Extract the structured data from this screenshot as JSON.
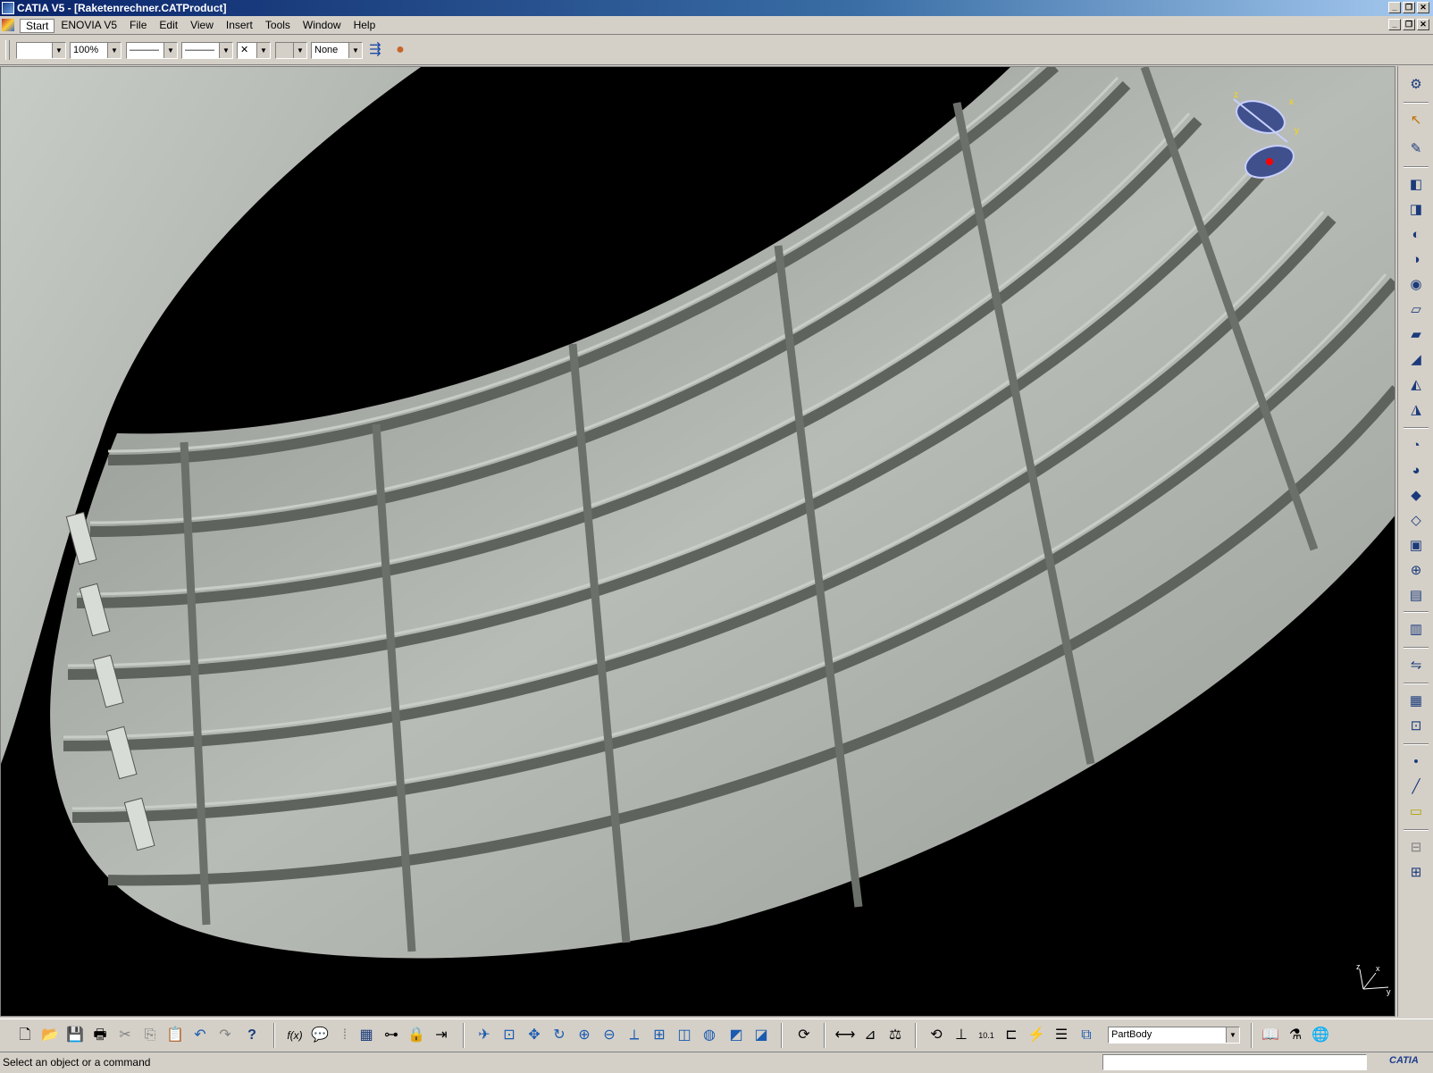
{
  "window": {
    "title": "CATIA V5 - [Raketenrechner.CATProduct]",
    "controls": [
      "_",
      "❐",
      "✕"
    ]
  },
  "menu": {
    "items": [
      "Start",
      "ENOVIA V5",
      "File",
      "Edit",
      "View",
      "Insert",
      "Tools",
      "Window",
      "Help"
    ]
  },
  "toolbar": {
    "color_value": "",
    "transparency_value": "100%",
    "linetype_value": "———",
    "thickness_value": "———",
    "point_value": "✕",
    "layer_value": "None",
    "painter_icon": "format-painter-icon",
    "sphere_icon": "graphic-properties-icon"
  },
  "viewport": {
    "background": "#000000",
    "part_color": "#aeb2ac",
    "compass_icon": "compass-icon",
    "axis_labels": {
      "z": "z",
      "x": "x",
      "y": "y"
    }
  },
  "right_toolbar": {
    "icons": [
      {
        "name": "gear-icon",
        "glyph": "⚙"
      },
      {
        "name": "select-arrow-icon",
        "glyph": "↖"
      },
      {
        "name": "sketcher-icon",
        "glyph": "✎"
      },
      {
        "name": "pad-icon",
        "glyph": "◧"
      },
      {
        "name": "pocket-icon",
        "glyph": "◨"
      },
      {
        "name": "shaft-icon",
        "glyph": "◐"
      },
      {
        "name": "groove-icon",
        "glyph": "◑"
      },
      {
        "name": "hole-icon",
        "glyph": "◉"
      },
      {
        "name": "rib-icon",
        "glyph": "▱"
      },
      {
        "name": "slot-icon",
        "glyph": "▰"
      },
      {
        "name": "stiffener-icon",
        "glyph": "◢"
      },
      {
        "name": "loft-icon",
        "glyph": "◭"
      },
      {
        "name": "remove-loft-icon",
        "glyph": "◮"
      },
      {
        "name": "fillet-icon",
        "glyph": "◔"
      },
      {
        "name": "chamfer-icon",
        "glyph": "◕"
      },
      {
        "name": "draft-icon",
        "glyph": "◆"
      },
      {
        "name": "shell-icon",
        "glyph": "◇"
      },
      {
        "name": "thickness-icon",
        "glyph": "▣"
      },
      {
        "name": "thread-icon",
        "glyph": "⊕"
      },
      {
        "name": "remove-face-icon",
        "glyph": "▤"
      },
      {
        "name": "split-icon",
        "glyph": "▥"
      },
      {
        "name": "mirror-icon",
        "glyph": "⇋"
      },
      {
        "name": "pattern-icon",
        "glyph": "▦"
      },
      {
        "name": "scaling-icon",
        "glyph": "⊡"
      },
      {
        "name": "point-icon",
        "glyph": "•"
      },
      {
        "name": "line-icon",
        "glyph": "╱"
      },
      {
        "name": "plane-icon",
        "glyph": "▭"
      },
      {
        "name": "constraint-icon",
        "glyph": "⊟"
      },
      {
        "name": "annotation-icon",
        "glyph": "⊞"
      }
    ]
  },
  "bottom_toolbar": {
    "icons": [
      {
        "name": "new-file-icon",
        "glyph": "🗋"
      },
      {
        "name": "open-folder-icon",
        "glyph": "📂"
      },
      {
        "name": "save-icon",
        "glyph": "💾"
      },
      {
        "name": "print-icon",
        "glyph": "🖶"
      },
      {
        "name": "cut-icon",
        "glyph": "✂"
      },
      {
        "name": "copy-icon",
        "glyph": "⎘"
      },
      {
        "name": "paste-icon",
        "glyph": "📋"
      },
      {
        "name": "undo-icon",
        "glyph": "↶"
      },
      {
        "name": "redo-icon",
        "glyph": "↷"
      },
      {
        "name": "whats-this-icon",
        "glyph": "?"
      },
      {
        "name": "formula-icon",
        "glyph": "f(x)"
      },
      {
        "name": "comment-icon",
        "glyph": "💬"
      },
      {
        "name": "measure-icon",
        "glyph": "⁞"
      },
      {
        "name": "table-icon",
        "glyph": "▦"
      },
      {
        "name": "tree-icon",
        "glyph": "⊶"
      },
      {
        "name": "lock-icon",
        "glyph": "🔒"
      },
      {
        "name": "scan-icon",
        "glyph": "⇥"
      },
      {
        "name": "fly-mode-icon",
        "glyph": "✈"
      },
      {
        "name": "fit-all-icon",
        "glyph": "⊡"
      },
      {
        "name": "pan-icon",
        "glyph": "✥"
      },
      {
        "name": "rotate-icon",
        "glyph": "↻"
      },
      {
        "name": "zoom-in-icon",
        "glyph": "⊕"
      },
      {
        "name": "zoom-out-icon",
        "glyph": "⊖"
      },
      {
        "name": "normal-view-icon",
        "glyph": "⟂"
      },
      {
        "name": "multi-view-icon",
        "glyph": "⊞"
      },
      {
        "name": "iso-view-icon",
        "glyph": "◫"
      },
      {
        "name": "shading-icon",
        "glyph": "◍"
      },
      {
        "name": "hide-show-icon",
        "glyph": "◩"
      },
      {
        "name": "swap-space-icon",
        "glyph": "◪"
      },
      {
        "name": "update-icon",
        "glyph": "⟳"
      },
      {
        "name": "measure-between-icon",
        "glyph": "⟷"
      },
      {
        "name": "measure-item-icon",
        "glyph": "⊿"
      },
      {
        "name": "mass-icon",
        "glyph": "⚖"
      },
      {
        "name": "spin-icon",
        "glyph": "⟲"
      },
      {
        "name": "axis-system-icon",
        "glyph": "⊥"
      },
      {
        "name": "units-icon",
        "glyph": "10.1"
      },
      {
        "name": "snap-icon",
        "glyph": "⊏"
      },
      {
        "name": "sketch-analysis-icon",
        "glyph": "⚡"
      },
      {
        "name": "hierarchy-icon",
        "glyph": "☰"
      },
      {
        "name": "work-object-icon",
        "glyph": "⧉"
      },
      {
        "name": "catalog-icon",
        "glyph": "📖"
      },
      {
        "name": "knowledge-icon",
        "glyph": "⚗"
      },
      {
        "name": "web-icon",
        "glyph": "🌐"
      }
    ],
    "work_object_value": "PartBody"
  },
  "status": {
    "text": "Select an object or a command",
    "command_input": "",
    "logo": "CATIA"
  }
}
